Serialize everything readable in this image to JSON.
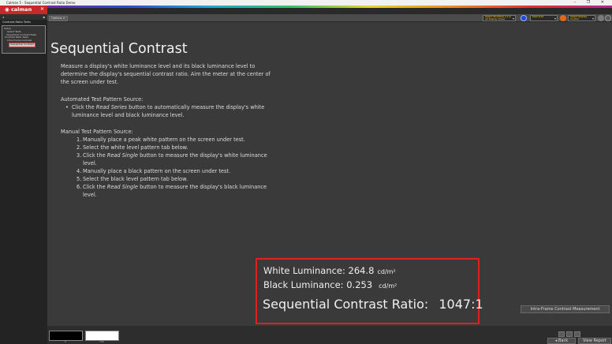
{
  "window": {
    "title": "Calman 5 - Sequential Contrast Ratio Demo",
    "controls": "– ❐ ✕"
  },
  "app": {
    "logo_text": "calman",
    "tab_label": "Options",
    "sidebar_title": "Contrast Ratio Tests"
  },
  "toolbar": {
    "source_select": {
      "line1": "Select Workflow 1.1.0",
      "line2": "All Display Types"
    },
    "meter_select": {
      "line1": "Klein K10",
      "line2": ""
    },
    "display_select": {
      "line1": "Select Display Control",
      "line2": ""
    },
    "colors": {
      "blue_dot": "#1f45d8",
      "orange_dot": "#e06a1a",
      "grey_dot": "#7a7a7a"
    }
  },
  "sidebar": {
    "items": [
      "Setup",
      "Select Tests",
      "Sequential Contrast Tests",
      "Contrast Ratio Tests",
      "Intra-Frame Contrast",
      "Sequential Contrast"
    ],
    "selected_item": "Sequential Contrast"
  },
  "content": {
    "title": "Sequential Contrast",
    "intro_lines": [
      "Measure a display's white luminance level and its black luminance level to",
      "determine the display's sequential contrast ratio. Aim the meter at the center of",
      "the screen under test."
    ],
    "auto_heading": "Automated Test Pattern Source:",
    "auto_line1_pre": "Click the ",
    "auto_line1_em": "Read Series",
    "auto_line1_post": " button to automatically measure the display's white",
    "auto_line2": "luminance level and black luminance level.",
    "manual_heading": "Manual Test Pattern Source:",
    "steps": [
      {
        "n": "1.",
        "pre": "Manually place a peak white pattern on the screen under test.",
        "em": "",
        "post": "",
        "cont": ""
      },
      {
        "n": "2.",
        "pre": "Select the white level pattern tab below.",
        "em": "",
        "post": "",
        "cont": ""
      },
      {
        "n": "3.",
        "pre": "Click the ",
        "em": "Read Single",
        "post": " button to measure the display's white luminance",
        "cont": "level."
      },
      {
        "n": "4.",
        "pre": "Manually place a black pattern on the screen under test.",
        "em": "",
        "post": "",
        "cont": ""
      },
      {
        "n": "5.",
        "pre": "Select the black level pattern tab below.",
        "em": "",
        "post": "",
        "cont": ""
      },
      {
        "n": "6.",
        "pre": "Click the ",
        "em": "Read Single",
        "post": " button to measure the display's black luminance",
        "cont": "level."
      }
    ]
  },
  "results": {
    "white_label": "White Luminance:",
    "white_value": "264.8",
    "black_label": "Black Luminance:",
    "black_value": "0.253",
    "unit": "cd/m²",
    "ratio_label": "Sequential Contrast Ratio:",
    "ratio_value": "1047:1",
    "border_color": "#e02020"
  },
  "buttons": {
    "intra_frame": "Intra-Frame Contrast Measurement",
    "back": "Back",
    "view_report": "View Report"
  },
  "patterns": {
    "black_label": "0",
    "white_label": "100"
  }
}
